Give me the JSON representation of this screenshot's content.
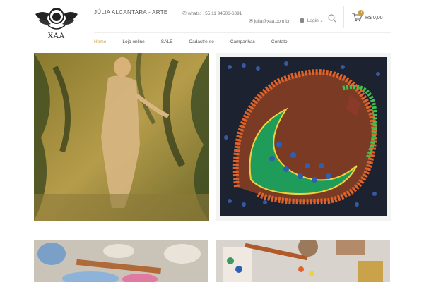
{
  "brand": {
    "name": "JÚLIA ALCANTARA - ARTE",
    "logo_text": "XAA"
  },
  "contact": {
    "whats": "whats: +55 11 94506-6091",
    "email": "julia@xaa.com.br"
  },
  "account": {
    "login_label": "Login"
  },
  "cart": {
    "count": "0",
    "total": "R$ 0,00"
  },
  "nav": {
    "items": [
      {
        "label": "Home",
        "active": true
      },
      {
        "label": "Loja online"
      },
      {
        "label": "SALE"
      },
      {
        "label": "Cadastre-se"
      },
      {
        "label": "Campanhas"
      },
      {
        "label": "Contato"
      }
    ]
  },
  "colors": {
    "accent": "#c9a04a",
    "text": "#555555"
  },
  "icons": [
    "phone-icon",
    "mail-icon",
    "lock-icon",
    "chevron-down-icon",
    "search-icon",
    "cart-icon"
  ]
}
